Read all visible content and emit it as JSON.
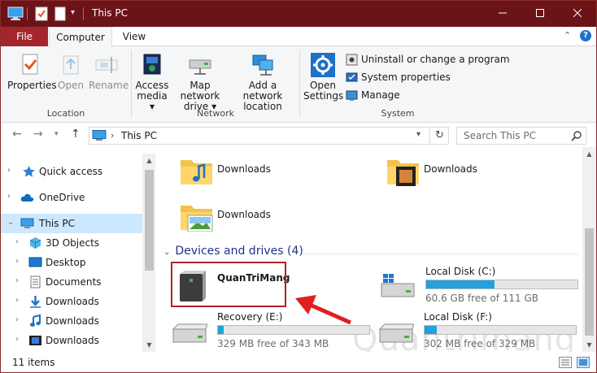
{
  "window": {
    "title": "This PC"
  },
  "tabs": {
    "file": "File",
    "computer": "Computer",
    "view": "View"
  },
  "ribbon": {
    "location": {
      "label": "Location",
      "properties": "Properties",
      "open": "Open",
      "rename": "Rename"
    },
    "network": {
      "label": "Network",
      "access_media": [
        "Access",
        "media"
      ],
      "map_drive": [
        "Map network",
        "drive"
      ],
      "add_location": [
        "Add a network",
        "location"
      ]
    },
    "system": {
      "label": "System",
      "open_settings": [
        "Open",
        "Settings"
      ],
      "uninstall": "Uninstall or change a program",
      "system_properties": "System properties",
      "manage": "Manage"
    }
  },
  "address": {
    "path": "This PC",
    "search_placeholder": "Search This PC"
  },
  "nav": {
    "items": [
      {
        "label": "Quick access"
      },
      {
        "label": "OneDrive"
      },
      {
        "label": "This PC"
      },
      {
        "label": "3D Objects"
      },
      {
        "label": "Desktop"
      },
      {
        "label": "Documents"
      },
      {
        "label": "Downloads"
      },
      {
        "label": "Downloads"
      },
      {
        "label": "Downloads"
      }
    ]
  },
  "folders": [
    {
      "label": "Downloads"
    },
    {
      "label": "Downloads"
    },
    {
      "label": "Downloads"
    }
  ],
  "devices": {
    "heading": "Devices and drives (4)",
    "drives": [
      {
        "name": "QuanTriMang"
      },
      {
        "name": "Local Disk (C:)",
        "free": "60.6 GB free of 111 GB",
        "used_fraction": 0.45
      },
      {
        "name": "Recovery (E:)",
        "free": "329 MB free of 343 MB",
        "used_fraction": 0.04
      },
      {
        "name": "Local Disk (F:)",
        "free": "302 MB free of 329 MB",
        "used_fraction": 0.08
      }
    ]
  },
  "status": {
    "count": "11 items"
  },
  "colors": {
    "titlebar": "#6b1418",
    "file_tab": "#a4262c",
    "accent": "#26a0da",
    "highlight": "#b0242a",
    "selection": "#cce8ff"
  }
}
